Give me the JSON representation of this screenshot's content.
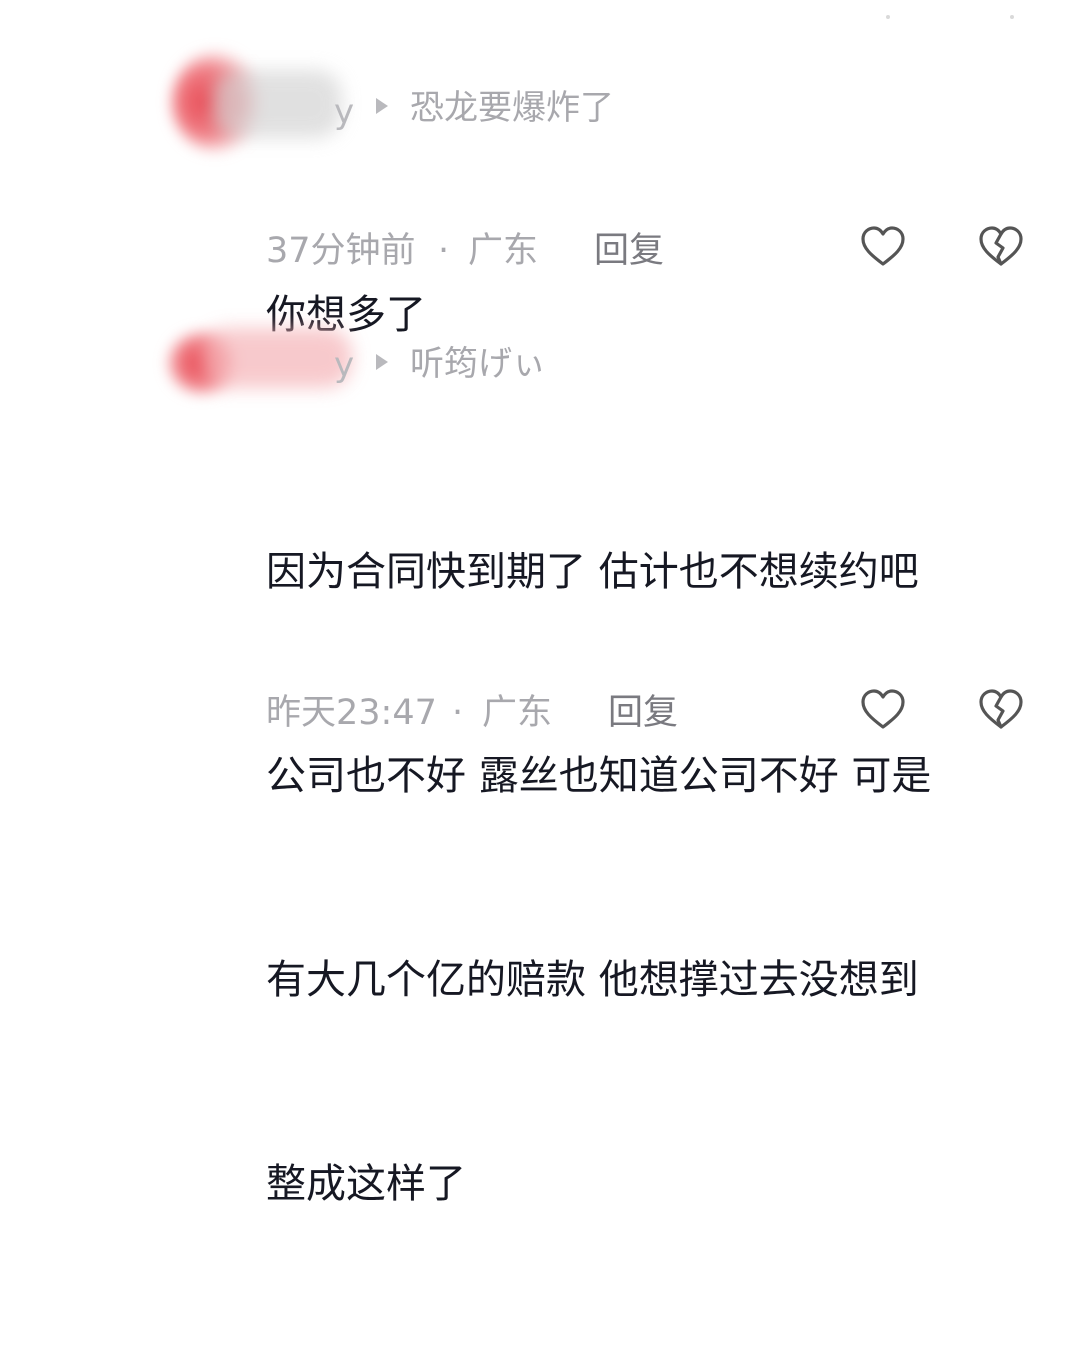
{
  "comments": [
    {
      "author_tail": "y",
      "reply_to": "恐龙要爆炸了",
      "lines": [
        "你想多了"
      ],
      "time": "37分钟前",
      "location": "广东",
      "separator": "·",
      "reply_label": "回复"
    },
    {
      "author_tail": "y",
      "reply_to": "听筠げぃ",
      "lines": [
        "因为合同快到期了 估计也不想续约吧",
        "公司也不好 露丝也知道公司不好 可是",
        "有大几个亿的赔款 他想撑过去没想到",
        "整成这样了"
      ],
      "time": "昨天23:47",
      "location": "广东",
      "separator": "·",
      "reply_label": "回复"
    }
  ],
  "icons": {
    "like": "heart-outline-icon",
    "dislike": "broken-heart-icon"
  },
  "colors": {
    "text_primary": "#161823",
    "text_secondary": "#a8a8ad",
    "reply_button": "#7a7a80",
    "icon_stroke": "#555555",
    "avatar_blur": "#e8434e"
  }
}
